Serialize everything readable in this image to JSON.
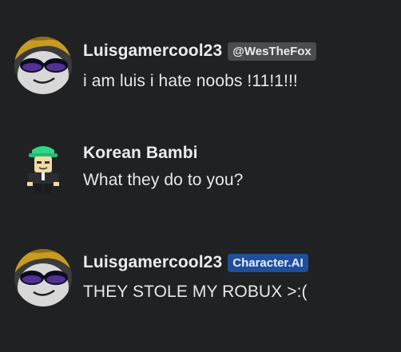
{
  "colors": {
    "background": "#202123",
    "username_badge_bg": "#4a4c50",
    "ai_badge_bg": "#1f4f9c"
  },
  "messages": [
    {
      "author": "Luisgamercool23",
      "badge": "@WesTheFox",
      "badge_type": "username",
      "text": "i am luis i hate noobs !11!1!!!",
      "avatar_icon": "roblox-avatar-sunglasses-icon"
    },
    {
      "author": "Korean Bambi",
      "text": "What they do to you?",
      "avatar_icon": "roblox-character-green-cap-icon"
    },
    {
      "author": "Luisgamercool23",
      "badge": "Character.AI",
      "badge_type": "ai",
      "text": "THEY STOLE MY ROBUX >:(",
      "avatar_icon": "roblox-avatar-sunglasses-icon"
    }
  ]
}
